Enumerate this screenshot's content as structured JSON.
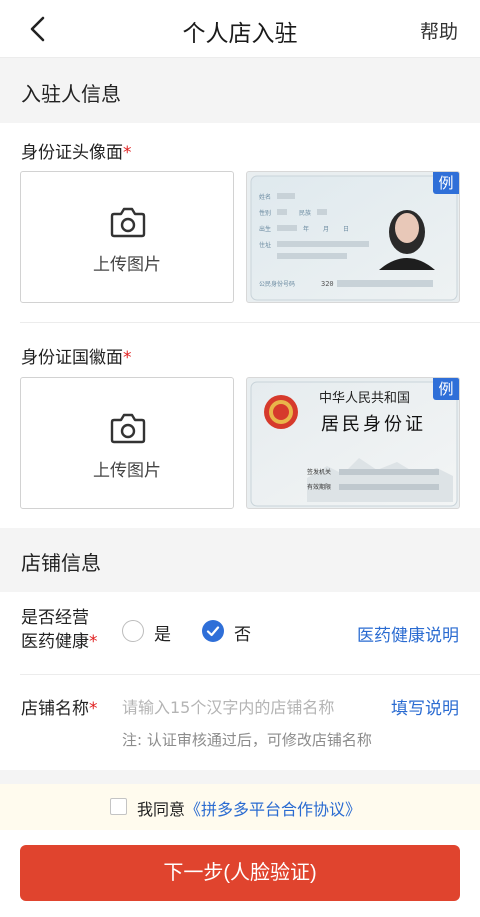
{
  "header": {
    "title": "个人店入驻",
    "help_label": "帮助"
  },
  "section_applicant": {
    "title": "入驻人信息",
    "id_front": {
      "label": "身份证头像面",
      "required_mark": "*",
      "upload_label": "上传图片",
      "example_tag": "例"
    },
    "id_back": {
      "label": "身份证国徽面",
      "required_mark": "*",
      "upload_label": "上传图片",
      "example_tag": "例",
      "card_country": "中华人民共和国",
      "card_title": "居民身份证",
      "issuer_label": "签发机关",
      "validity_label": "有效期限"
    },
    "front_card": {
      "name_label": "姓名",
      "gender_label": "性别",
      "ethnicity_label": "民族",
      "birth_label": "出生",
      "year": "年",
      "month": "月",
      "day": "日",
      "address_label": "住址",
      "idno_label": "公民身份号码",
      "idno_prefix": "320"
    }
  },
  "section_shop": {
    "title": "店铺信息",
    "medical": {
      "label_line1": "是否经营",
      "label_line2": "医药健康",
      "required_mark": "*",
      "yes": "是",
      "no": "否",
      "selected": "否",
      "link": "医药健康说明"
    },
    "shop_name": {
      "label": "店铺名称",
      "required_mark": "*",
      "placeholder": "请输入15个汉字内的店铺名称",
      "link": "填写说明",
      "note": "注: 认证审核通过后，可修改店铺名称"
    }
  },
  "agreement": {
    "prefix": "我同意",
    "link": "《拼多多平台合作协议》"
  },
  "footer": {
    "next_button": "下一步(人脸验证)"
  },
  "colors": {
    "accent_blue": "#2f6fd8",
    "link_blue": "#2a6bd1",
    "primary_red": "#e0442e",
    "required_red": "#e02020"
  }
}
